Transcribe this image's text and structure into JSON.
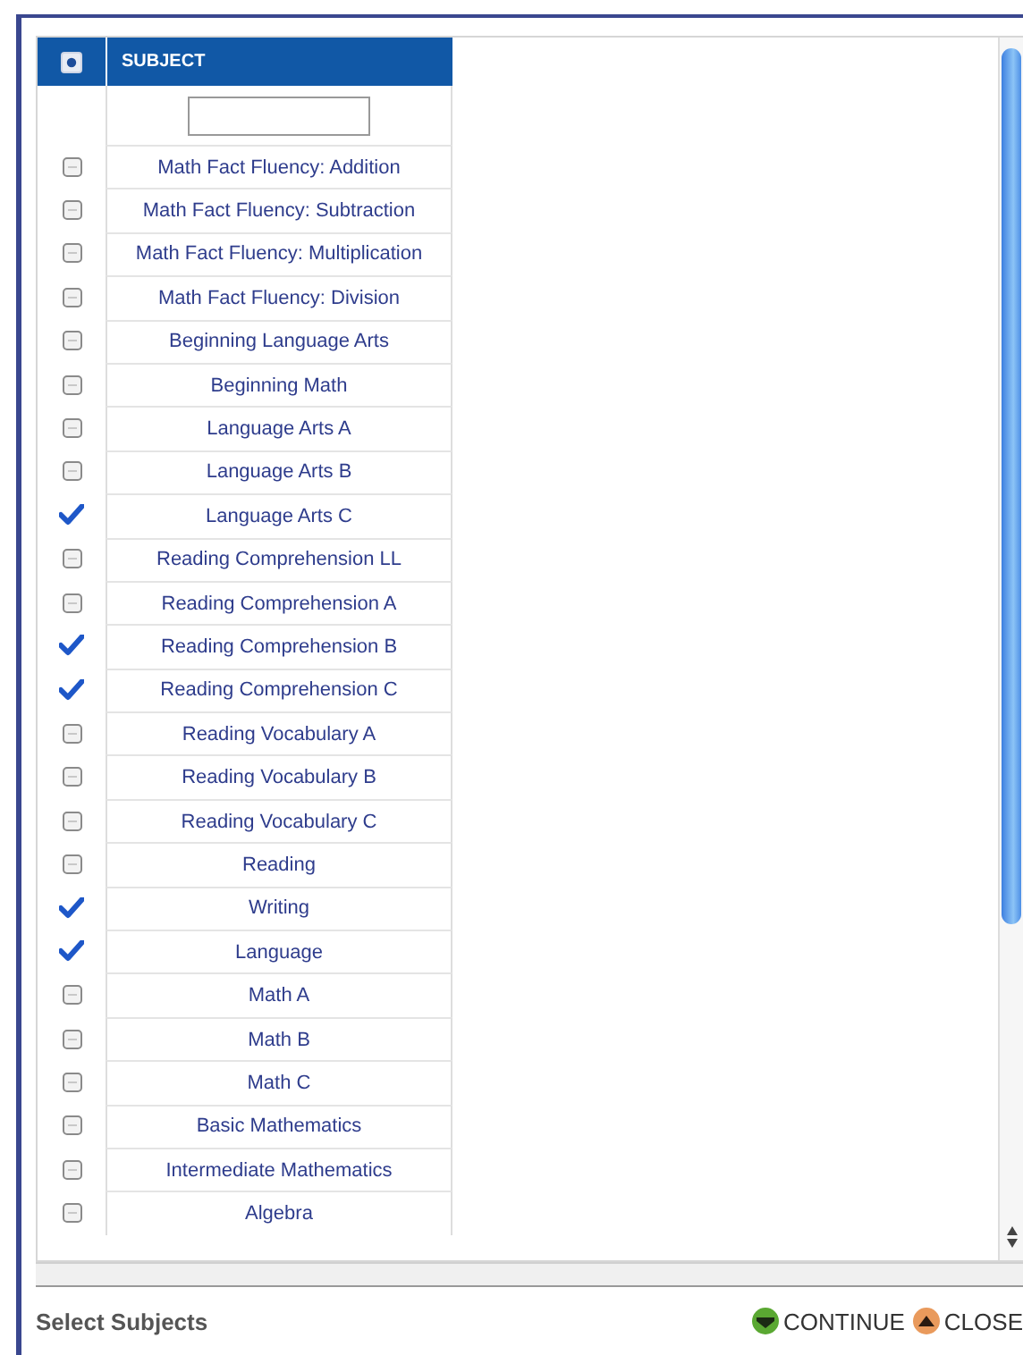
{
  "table": {
    "select_all": {
      "partial": true
    },
    "column_heading": "SUBJECT",
    "rows": [
      {
        "subject": "Math Fact Fluency: Addition",
        "checked": false
      },
      {
        "subject": "Math Fact Fluency: Subtraction",
        "checked": false
      },
      {
        "subject": "Math Fact Fluency: Multiplication",
        "checked": false
      },
      {
        "subject": "Math Fact Fluency: Division",
        "checked": false
      },
      {
        "subject": "Beginning Language Arts",
        "checked": false
      },
      {
        "subject": "Beginning Math",
        "checked": false
      },
      {
        "subject": "Language Arts A",
        "checked": false
      },
      {
        "subject": "Language Arts B",
        "checked": false
      },
      {
        "subject": "Language Arts C",
        "checked": true
      },
      {
        "subject": "Reading Comprehension LL",
        "checked": false
      },
      {
        "subject": "Reading Comprehension A",
        "checked": false
      },
      {
        "subject": "Reading Comprehension B",
        "checked": true
      },
      {
        "subject": "Reading Comprehension C",
        "checked": true
      },
      {
        "subject": "Reading Vocabulary A",
        "checked": false
      },
      {
        "subject": "Reading Vocabulary B",
        "checked": false
      },
      {
        "subject": "Reading Vocabulary C",
        "checked": false
      },
      {
        "subject": "Reading",
        "checked": false
      },
      {
        "subject": "Writing",
        "checked": true
      },
      {
        "subject": "Language",
        "checked": true
      },
      {
        "subject": "Math A",
        "checked": false
      },
      {
        "subject": "Math B",
        "checked": false
      },
      {
        "subject": "Math C",
        "checked": false
      },
      {
        "subject": "Basic Mathematics",
        "checked": false
      },
      {
        "subject": "Intermediate Mathematics",
        "checked": false
      },
      {
        "subject": "Algebra",
        "checked": false
      }
    ]
  },
  "footer": {
    "title": "Select Subjects",
    "buttons": [
      {
        "label": "CONTINUE",
        "kind": "continue"
      },
      {
        "label": "CLOSE",
        "kind": "close"
      }
    ]
  }
}
